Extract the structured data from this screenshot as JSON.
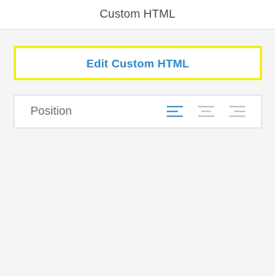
{
  "header": {
    "title": "Custom HTML"
  },
  "edit_button": {
    "label": "Edit Custom HTML"
  },
  "position": {
    "label": "Position",
    "options": [
      {
        "name": "align-left-icon",
        "selected": true
      },
      {
        "name": "align-center-icon",
        "selected": false
      },
      {
        "name": "align-right-icon",
        "selected": false
      }
    ]
  },
  "colors": {
    "accent": "#2c86c4",
    "highlight_border": "#f2ee1e",
    "inactive_icon": "#b9b9b9",
    "background": "#f5f5f5"
  }
}
